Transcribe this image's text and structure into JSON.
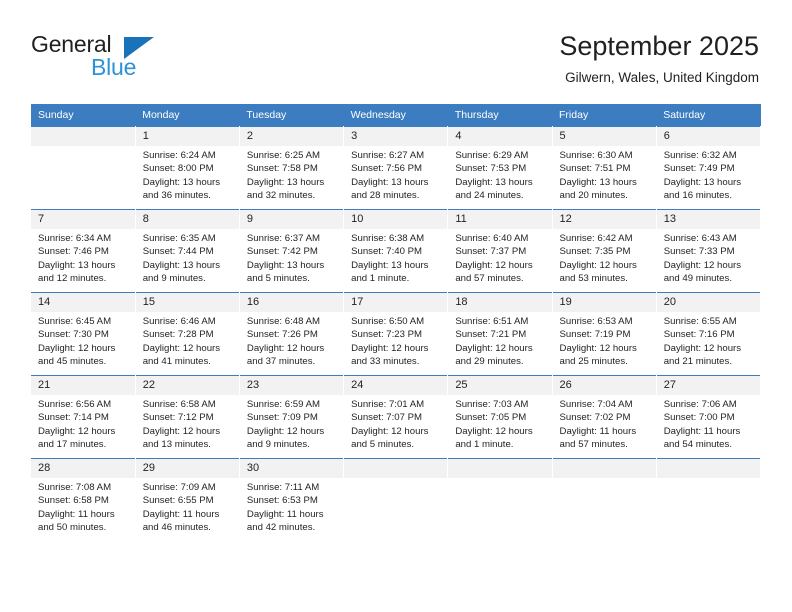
{
  "brand": {
    "name_top": "General",
    "name_bottom": "Blue",
    "triangle_color": "#1a72b8",
    "blue_text_color": "#2e92d8"
  },
  "header": {
    "title": "September 2025",
    "subtitle": "Gilwern, Wales, United Kingdom"
  },
  "theme": {
    "header_blue": "#3b7dc0",
    "daynum_band": "#f2f2f2",
    "text": "#231f20"
  },
  "weekdays": [
    "Sunday",
    "Monday",
    "Tuesday",
    "Wednesday",
    "Thursday",
    "Friday",
    "Saturday"
  ],
  "days": [
    {
      "date": "",
      "sunrise": "",
      "sunset": "",
      "daylight": ""
    },
    {
      "date": "1",
      "sunrise": "Sunrise: 6:24 AM",
      "sunset": "Sunset: 8:00 PM",
      "daylight": "Daylight: 13 hours and 36 minutes."
    },
    {
      "date": "2",
      "sunrise": "Sunrise: 6:25 AM",
      "sunset": "Sunset: 7:58 PM",
      "daylight": "Daylight: 13 hours and 32 minutes."
    },
    {
      "date": "3",
      "sunrise": "Sunrise: 6:27 AM",
      "sunset": "Sunset: 7:56 PM",
      "daylight": "Daylight: 13 hours and 28 minutes."
    },
    {
      "date": "4",
      "sunrise": "Sunrise: 6:29 AM",
      "sunset": "Sunset: 7:53 PM",
      "daylight": "Daylight: 13 hours and 24 minutes."
    },
    {
      "date": "5",
      "sunrise": "Sunrise: 6:30 AM",
      "sunset": "Sunset: 7:51 PM",
      "daylight": "Daylight: 13 hours and 20 minutes."
    },
    {
      "date": "6",
      "sunrise": "Sunrise: 6:32 AM",
      "sunset": "Sunset: 7:49 PM",
      "daylight": "Daylight: 13 hours and 16 minutes."
    },
    {
      "date": "7",
      "sunrise": "Sunrise: 6:34 AM",
      "sunset": "Sunset: 7:46 PM",
      "daylight": "Daylight: 13 hours and 12 minutes."
    },
    {
      "date": "8",
      "sunrise": "Sunrise: 6:35 AM",
      "sunset": "Sunset: 7:44 PM",
      "daylight": "Daylight: 13 hours and 9 minutes."
    },
    {
      "date": "9",
      "sunrise": "Sunrise: 6:37 AM",
      "sunset": "Sunset: 7:42 PM",
      "daylight": "Daylight: 13 hours and 5 minutes."
    },
    {
      "date": "10",
      "sunrise": "Sunrise: 6:38 AM",
      "sunset": "Sunset: 7:40 PM",
      "daylight": "Daylight: 13 hours and 1 minute."
    },
    {
      "date": "11",
      "sunrise": "Sunrise: 6:40 AM",
      "sunset": "Sunset: 7:37 PM",
      "daylight": "Daylight: 12 hours and 57 minutes."
    },
    {
      "date": "12",
      "sunrise": "Sunrise: 6:42 AM",
      "sunset": "Sunset: 7:35 PM",
      "daylight": "Daylight: 12 hours and 53 minutes."
    },
    {
      "date": "13",
      "sunrise": "Sunrise: 6:43 AM",
      "sunset": "Sunset: 7:33 PM",
      "daylight": "Daylight: 12 hours and 49 minutes."
    },
    {
      "date": "14",
      "sunrise": "Sunrise: 6:45 AM",
      "sunset": "Sunset: 7:30 PM",
      "daylight": "Daylight: 12 hours and 45 minutes."
    },
    {
      "date": "15",
      "sunrise": "Sunrise: 6:46 AM",
      "sunset": "Sunset: 7:28 PM",
      "daylight": "Daylight: 12 hours and 41 minutes."
    },
    {
      "date": "16",
      "sunrise": "Sunrise: 6:48 AM",
      "sunset": "Sunset: 7:26 PM",
      "daylight": "Daylight: 12 hours and 37 minutes."
    },
    {
      "date": "17",
      "sunrise": "Sunrise: 6:50 AM",
      "sunset": "Sunset: 7:23 PM",
      "daylight": "Daylight: 12 hours and 33 minutes."
    },
    {
      "date": "18",
      "sunrise": "Sunrise: 6:51 AM",
      "sunset": "Sunset: 7:21 PM",
      "daylight": "Daylight: 12 hours and 29 minutes."
    },
    {
      "date": "19",
      "sunrise": "Sunrise: 6:53 AM",
      "sunset": "Sunset: 7:19 PM",
      "daylight": "Daylight: 12 hours and 25 minutes."
    },
    {
      "date": "20",
      "sunrise": "Sunrise: 6:55 AM",
      "sunset": "Sunset: 7:16 PM",
      "daylight": "Daylight: 12 hours and 21 minutes."
    },
    {
      "date": "21",
      "sunrise": "Sunrise: 6:56 AM",
      "sunset": "Sunset: 7:14 PM",
      "daylight": "Daylight: 12 hours and 17 minutes."
    },
    {
      "date": "22",
      "sunrise": "Sunrise: 6:58 AM",
      "sunset": "Sunset: 7:12 PM",
      "daylight": "Daylight: 12 hours and 13 minutes."
    },
    {
      "date": "23",
      "sunrise": "Sunrise: 6:59 AM",
      "sunset": "Sunset: 7:09 PM",
      "daylight": "Daylight: 12 hours and 9 minutes."
    },
    {
      "date": "24",
      "sunrise": "Sunrise: 7:01 AM",
      "sunset": "Sunset: 7:07 PM",
      "daylight": "Daylight: 12 hours and 5 minutes."
    },
    {
      "date": "25",
      "sunrise": "Sunrise: 7:03 AM",
      "sunset": "Sunset: 7:05 PM",
      "daylight": "Daylight: 12 hours and 1 minute."
    },
    {
      "date": "26",
      "sunrise": "Sunrise: 7:04 AM",
      "sunset": "Sunset: 7:02 PM",
      "daylight": "Daylight: 11 hours and 57 minutes."
    },
    {
      "date": "27",
      "sunrise": "Sunrise: 7:06 AM",
      "sunset": "Sunset: 7:00 PM",
      "daylight": "Daylight: 11 hours and 54 minutes."
    },
    {
      "date": "28",
      "sunrise": "Sunrise: 7:08 AM",
      "sunset": "Sunset: 6:58 PM",
      "daylight": "Daylight: 11 hours and 50 minutes."
    },
    {
      "date": "29",
      "sunrise": "Sunrise: 7:09 AM",
      "sunset": "Sunset: 6:55 PM",
      "daylight": "Daylight: 11 hours and 46 minutes."
    },
    {
      "date": "30",
      "sunrise": "Sunrise: 7:11 AM",
      "sunset": "Sunset: 6:53 PM",
      "daylight": "Daylight: 11 hours and 42 minutes."
    },
    {
      "date": "",
      "sunrise": "",
      "sunset": "",
      "daylight": ""
    },
    {
      "date": "",
      "sunrise": "",
      "sunset": "",
      "daylight": ""
    },
    {
      "date": "",
      "sunrise": "",
      "sunset": "",
      "daylight": ""
    },
    {
      "date": "",
      "sunrise": "",
      "sunset": "",
      "daylight": ""
    }
  ]
}
